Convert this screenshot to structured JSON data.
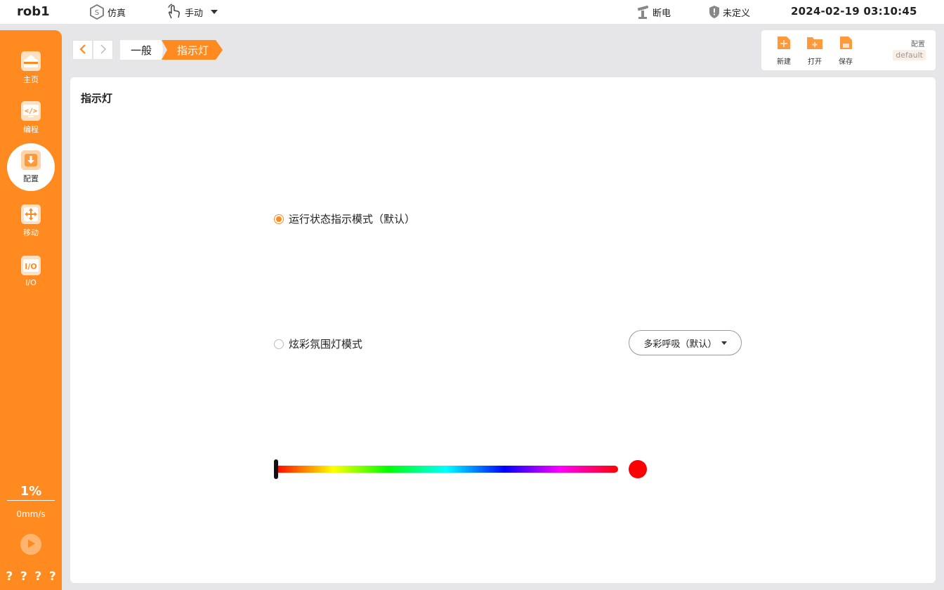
{
  "topbar": {
    "robot_name": "rob1",
    "sim_label": "仿真",
    "mode_label": "手动",
    "power_label": "断电",
    "safety_label": "未定义",
    "datetime": "2024-02-19 03:10:45"
  },
  "sidebar": {
    "items": [
      {
        "label": "主页",
        "icon": "home-icon"
      },
      {
        "label": "编程",
        "icon": "code-icon"
      },
      {
        "label": "配置",
        "icon": "config-icon",
        "active": true
      },
      {
        "label": "移动",
        "icon": "move-icon"
      },
      {
        "label": "I/O",
        "icon": "io-icon"
      }
    ],
    "speed_percent": "1%",
    "speed_mm": "0mm/s",
    "help_marks": [
      "?",
      "?",
      "?",
      "?"
    ]
  },
  "breadcrumb": {
    "items": [
      "一般",
      "指示灯"
    ]
  },
  "config_panel": {
    "new_label": "新建",
    "open_label": "打开",
    "save_label": "保存",
    "config_label": "配置",
    "config_value": "default"
  },
  "main": {
    "title": "指示灯",
    "options": [
      {
        "label": "运行状态指示模式（默认）",
        "selected": true
      },
      {
        "label": "炫彩氛围灯模式",
        "selected": false
      }
    ],
    "effect_select": {
      "value": "多彩呼吸（默认）"
    },
    "hue_slider": {
      "value": 0
    },
    "selected_color": "#ff0000"
  },
  "colors": {
    "accent": "#ff8a1f",
    "sidebar_bg": "#ff8a1f"
  }
}
